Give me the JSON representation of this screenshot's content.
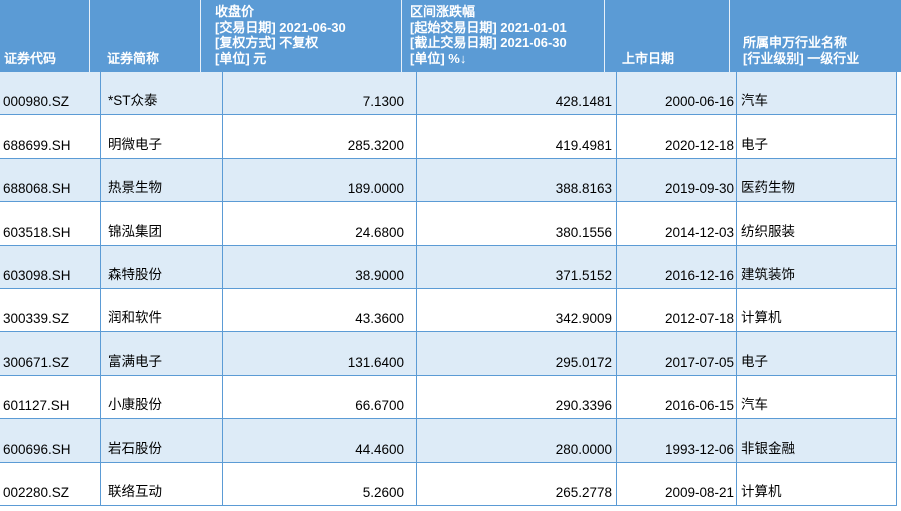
{
  "colors": {
    "header_bg": "#5B9BD5",
    "header_text": "#FFFFFF",
    "header_separator": "#E7F0F9",
    "row_alt_bg": "#DDEBF7",
    "row_bg": "#FFFFFF",
    "grid_line": "#5B9BD5",
    "cell_text": "#000000"
  },
  "table": {
    "sort_indicator": "↓",
    "columns": [
      {
        "name": "security-code",
        "header_lines": [
          "证券代码"
        ]
      },
      {
        "name": "security-name",
        "header_lines": [
          "证券简称"
        ]
      },
      {
        "name": "close-price",
        "header_lines": [
          "收盘价",
          "[交易日期] 2021-06-30",
          "[复权方式] 不复权",
          "[单位] 元"
        ]
      },
      {
        "name": "interval-change",
        "header_lines": [
          "区间涨跌幅",
          "[起始交易日期] 2021-01-01",
          "[截止交易日期] 2021-06-30",
          "[单位] %↓"
        ]
      },
      {
        "name": "listing-date",
        "header_lines": [
          "上市日期"
        ]
      },
      {
        "name": "sw-industry",
        "header_lines": [
          "所属申万行业名称",
          "[行业级别] 一级行业"
        ]
      }
    ],
    "rows": [
      [
        "000980.SZ",
        "*ST众泰",
        "7.1300",
        "428.1481",
        "2000-06-16",
        "汽车"
      ],
      [
        "688699.SH",
        "明微电子",
        "285.3200",
        "419.4981",
        "2020-12-18",
        "电子"
      ],
      [
        "688068.SH",
        "热景生物",
        "189.0000",
        "388.8163",
        "2019-09-30",
        "医药生物"
      ],
      [
        "603518.SH",
        "锦泓集团",
        "24.6800",
        "380.1556",
        "2014-12-03",
        "纺织服装"
      ],
      [
        "603098.SH",
        "森特股份",
        "38.9000",
        "371.5152",
        "2016-12-16",
        "建筑装饰"
      ],
      [
        "300339.SZ",
        "润和软件",
        "43.3600",
        "342.9009",
        "2012-07-18",
        "计算机"
      ],
      [
        "300671.SZ",
        "富满电子",
        "131.6400",
        "295.0172",
        "2017-07-05",
        "电子"
      ],
      [
        "601127.SH",
        "小康股份",
        "66.6700",
        "290.3396",
        "2016-06-15",
        "汽车"
      ],
      [
        "600696.SH",
        "岩石股份",
        "44.4600",
        "280.0000",
        "1993-12-06",
        "非银金融"
      ],
      [
        "002280.SZ",
        "联络互动",
        "5.2600",
        "265.2778",
        "2009-08-21",
        "计算机"
      ]
    ]
  }
}
